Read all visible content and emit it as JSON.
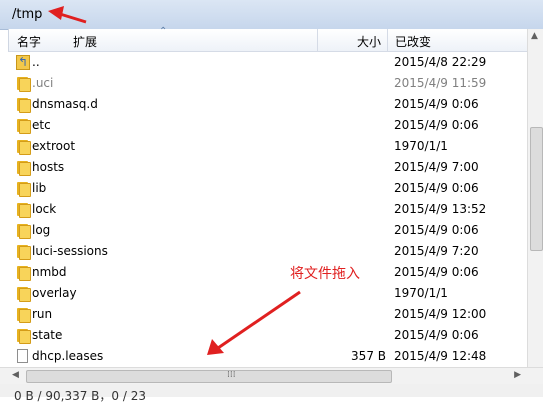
{
  "path": "/tmp",
  "columns": {
    "name": "名字",
    "ext": "扩展",
    "size": "大小",
    "date": "已改变"
  },
  "files": [
    {
      "name": "..",
      "size": "",
      "date": "2015/4/8 22:29",
      "type": "up"
    },
    {
      "name": ".uci",
      "size": "",
      "date": "2015/4/9 11:59",
      "type": "folder",
      "dim": true
    },
    {
      "name": "dnsmasq.d",
      "size": "",
      "date": "2015/4/9 0:06",
      "type": "folder"
    },
    {
      "name": "etc",
      "size": "",
      "date": "2015/4/9 0:06",
      "type": "folder"
    },
    {
      "name": "extroot",
      "size": "",
      "date": "1970/1/1",
      "type": "folder"
    },
    {
      "name": "hosts",
      "size": "",
      "date": "2015/4/9 7:00",
      "type": "folder"
    },
    {
      "name": "lib",
      "size": "",
      "date": "2015/4/9 0:06",
      "type": "folder"
    },
    {
      "name": "lock",
      "size": "",
      "date": "2015/4/9 13:52",
      "type": "folder"
    },
    {
      "name": "log",
      "size": "",
      "date": "2015/4/9 0:06",
      "type": "folder"
    },
    {
      "name": "luci-sessions",
      "size": "",
      "date": "2015/4/9 7:20",
      "type": "folder"
    },
    {
      "name": "nmbd",
      "size": "",
      "date": "2015/4/9 0:06",
      "type": "folder"
    },
    {
      "name": "overlay",
      "size": "",
      "date": "1970/1/1",
      "type": "folder"
    },
    {
      "name": "run",
      "size": "",
      "date": "2015/4/9 12:00",
      "type": "folder"
    },
    {
      "name": "state",
      "size": "",
      "date": "2015/4/9 0:06",
      "type": "folder"
    },
    {
      "name": "dhcp.leases",
      "size": "357 B",
      "date": "2015/4/9 12:48",
      "type": "file"
    }
  ],
  "annotation": {
    "text": "将文件拖入",
    "color": "#e02020"
  },
  "status": "0 B / 90,337 B，0 / 23"
}
